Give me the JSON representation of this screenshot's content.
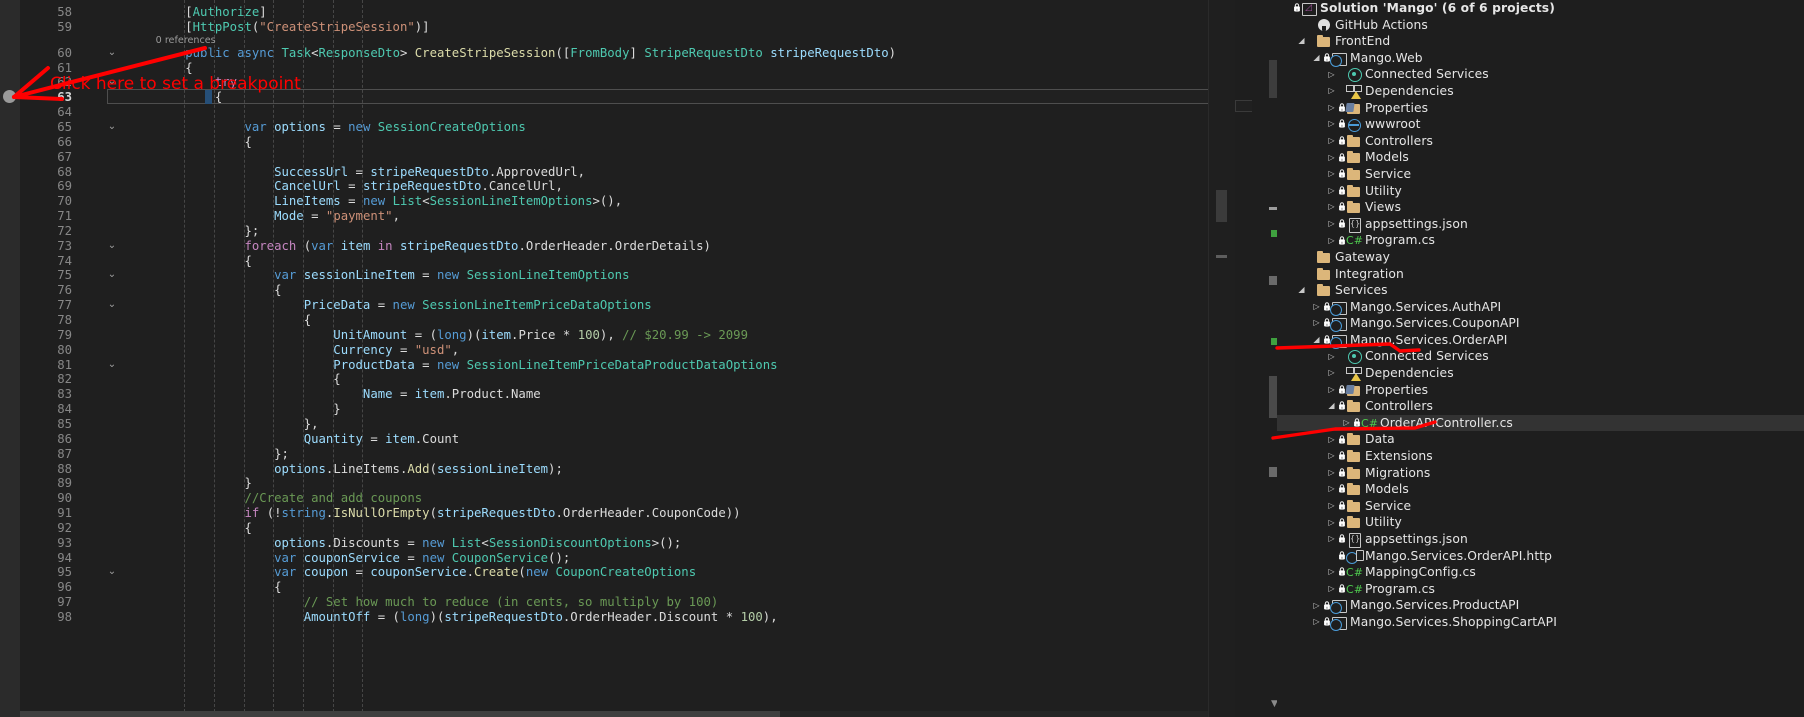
{
  "editor": {
    "file": "OrderAPIController.cs",
    "current_line": 63,
    "breakpoint_marker": "breakpoint-placeholder-dot",
    "lines": [
      {
        "n": 58,
        "fold": "",
        "indent": 4,
        "text": "[Authorize]"
      },
      {
        "n": 59,
        "fold": "",
        "indent": 4,
        "text": "[HttpPost(\"CreateStripeSession\")]"
      },
      {
        "n": "",
        "fold": "",
        "indent": 4,
        "text": "0 references",
        "kind": "codelens"
      },
      {
        "n": 60,
        "fold": "v",
        "indent": 4,
        "text": "public async Task<ResponseDto> CreateStripeSession([FromBody] StripeRequestDto stripeRequestDto)"
      },
      {
        "n": 61,
        "fold": "",
        "indent": 4,
        "text": "{"
      },
      {
        "n": 62,
        "fold": "v",
        "indent": 6,
        "text": "try"
      },
      {
        "n": 63,
        "fold": "",
        "indent": 6,
        "text": "{"
      },
      {
        "n": 64,
        "fold": "",
        "indent": 0,
        "text": ""
      },
      {
        "n": 65,
        "fold": "v",
        "indent": 8,
        "text": "var options = new SessionCreateOptions"
      },
      {
        "n": 66,
        "fold": "",
        "indent": 8,
        "text": "{"
      },
      {
        "n": 67,
        "fold": "",
        "indent": 0,
        "text": ""
      },
      {
        "n": 68,
        "fold": "",
        "indent": 10,
        "text": "SuccessUrl = stripeRequestDto.ApprovedUrl,"
      },
      {
        "n": 69,
        "fold": "",
        "indent": 10,
        "text": "CancelUrl = stripeRequestDto.CancelUrl,"
      },
      {
        "n": 70,
        "fold": "",
        "indent": 10,
        "text": "LineItems = new List<SessionLineItemOptions>(),"
      },
      {
        "n": 71,
        "fold": "",
        "indent": 10,
        "text": "Mode = \"payment\","
      },
      {
        "n": 72,
        "fold": "",
        "indent": 8,
        "text": "};"
      },
      {
        "n": 73,
        "fold": "v",
        "indent": 8,
        "text": "foreach (var item in stripeRequestDto.OrderHeader.OrderDetails)"
      },
      {
        "n": 74,
        "fold": "",
        "indent": 8,
        "text": "{"
      },
      {
        "n": 75,
        "fold": "v",
        "indent": 10,
        "text": "var sessionLineItem = new SessionLineItemOptions"
      },
      {
        "n": 76,
        "fold": "",
        "indent": 10,
        "text": "{"
      },
      {
        "n": 77,
        "fold": "v",
        "indent": 12,
        "text": "PriceData = new SessionLineItemPriceDataOptions"
      },
      {
        "n": 78,
        "fold": "",
        "indent": 12,
        "text": "{"
      },
      {
        "n": 79,
        "fold": "",
        "indent": 14,
        "text": "UnitAmount = (long)(item.Price * 100), // $20.99 -> 2099"
      },
      {
        "n": 80,
        "fold": "",
        "indent": 14,
        "text": "Currency = \"usd\","
      },
      {
        "n": 81,
        "fold": "v",
        "indent": 14,
        "text": "ProductData = new SessionLineItemPriceDataProductDataOptions"
      },
      {
        "n": 82,
        "fold": "",
        "indent": 14,
        "text": "{"
      },
      {
        "n": 83,
        "fold": "",
        "indent": 16,
        "text": "Name = item.Product.Name"
      },
      {
        "n": 84,
        "fold": "",
        "indent": 14,
        "text": "}"
      },
      {
        "n": 85,
        "fold": "",
        "indent": 12,
        "text": "},"
      },
      {
        "n": 86,
        "fold": "",
        "indent": 12,
        "text": "Quantity = item.Count"
      },
      {
        "n": 87,
        "fold": "",
        "indent": 10,
        "text": "};"
      },
      {
        "n": 88,
        "fold": "",
        "indent": 10,
        "text": "options.LineItems.Add(sessionLineItem);"
      },
      {
        "n": 89,
        "fold": "",
        "indent": 8,
        "text": "}"
      },
      {
        "n": 90,
        "fold": "",
        "indent": 8,
        "text": "//Create and add coupons"
      },
      {
        "n": 91,
        "fold": "",
        "indent": 8,
        "text": "if (!string.IsNullOrEmpty(stripeRequestDto.OrderHeader.CouponCode))"
      },
      {
        "n": 92,
        "fold": "",
        "indent": 8,
        "text": "{"
      },
      {
        "n": 93,
        "fold": "",
        "indent": 10,
        "text": "options.Discounts = new List<SessionDiscountOptions>();"
      },
      {
        "n": 94,
        "fold": "",
        "indent": 10,
        "text": "var couponService = new CouponService();"
      },
      {
        "n": 95,
        "fold": "v",
        "indent": 10,
        "text": "var coupon = couponService.Create(new CouponCreateOptions"
      },
      {
        "n": 96,
        "fold": "",
        "indent": 10,
        "text": "{"
      },
      {
        "n": 97,
        "fold": "",
        "indent": 12,
        "text": "// Set how much to reduce (in cents, so multiply by 100)"
      },
      {
        "n": 98,
        "fold": "",
        "indent": 12,
        "text": "AmountOff = (long)(stripeRequestDto.OrderHeader.Discount * 100),"
      }
    ],
    "codelens_label": "0 references"
  },
  "annotations": [
    {
      "id": "breakpoint-hint",
      "text": "Click here to set a breakpoint",
      "color": "#ff0000"
    }
  ],
  "solution_explorer": {
    "items": [
      {
        "depth": 0,
        "chev": "",
        "lock": true,
        "icon": "solution-icon",
        "label": "Solution 'Mango' (6 of 6 projects)",
        "bold": true,
        "selected": false
      },
      {
        "depth": 1,
        "chev": "",
        "lock": false,
        "icon": "github-icon",
        "label": "GitHub Actions",
        "bold": false,
        "selected": false
      },
      {
        "depth": 1,
        "chev": "open",
        "lock": false,
        "icon": "folder-icon",
        "label": "FrontEnd",
        "bold": false,
        "selected": false
      },
      {
        "depth": 2,
        "chev": "open",
        "lock": true,
        "icon": "project-web-icon",
        "label": "Mango.Web",
        "bold": false,
        "selected": false
      },
      {
        "depth": 3,
        "chev": "closed",
        "lock": false,
        "icon": "connected-services-icon",
        "label": "Connected Services",
        "bold": false,
        "selected": false
      },
      {
        "depth": 3,
        "chev": "closed",
        "lock": false,
        "icon": "dependencies-icon",
        "label": "Dependencies",
        "bold": false,
        "selected": false
      },
      {
        "depth": 3,
        "chev": "closed",
        "lock": true,
        "icon": "properties-icon",
        "label": "Properties",
        "bold": false,
        "selected": false
      },
      {
        "depth": 3,
        "chev": "closed",
        "lock": true,
        "icon": "wwwroot-icon",
        "label": "wwwroot",
        "bold": false,
        "selected": false
      },
      {
        "depth": 3,
        "chev": "closed",
        "lock": true,
        "icon": "folder-icon",
        "label": "Controllers",
        "bold": false,
        "selected": false
      },
      {
        "depth": 3,
        "chev": "closed",
        "lock": true,
        "icon": "folder-icon",
        "label": "Models",
        "bold": false,
        "selected": false
      },
      {
        "depth": 3,
        "chev": "closed",
        "lock": true,
        "icon": "folder-icon",
        "label": "Service",
        "bold": false,
        "selected": false
      },
      {
        "depth": 3,
        "chev": "closed",
        "lock": true,
        "icon": "folder-icon",
        "label": "Utility",
        "bold": false,
        "selected": false
      },
      {
        "depth": 3,
        "chev": "closed",
        "lock": true,
        "icon": "folder-icon",
        "label": "Views",
        "bold": false,
        "selected": false
      },
      {
        "depth": 3,
        "chev": "closed",
        "lock": true,
        "icon": "json-icon",
        "label": "appsettings.json",
        "bold": false,
        "selected": false
      },
      {
        "depth": 3,
        "chev": "closed",
        "lock": true,
        "icon": "csharp-icon",
        "label": "Program.cs",
        "bold": false,
        "selected": false
      },
      {
        "depth": 1,
        "chev": "",
        "lock": false,
        "icon": "folder-icon",
        "label": "Gateway",
        "bold": false,
        "selected": false
      },
      {
        "depth": 1,
        "chev": "",
        "lock": false,
        "icon": "folder-icon",
        "label": "Integration",
        "bold": false,
        "selected": false
      },
      {
        "depth": 1,
        "chev": "open",
        "lock": false,
        "icon": "folder-icon",
        "label": "Services",
        "bold": false,
        "selected": false
      },
      {
        "depth": 2,
        "chev": "closed",
        "lock": true,
        "icon": "project-web-icon",
        "label": "Mango.Services.AuthAPI",
        "bold": false,
        "selected": false
      },
      {
        "depth": 2,
        "chev": "closed",
        "lock": true,
        "icon": "project-web-icon",
        "label": "Mango.Services.CouponAPI",
        "bold": false,
        "selected": false
      },
      {
        "depth": 2,
        "chev": "open",
        "lock": true,
        "icon": "project-web-icon",
        "label": "Mango.Services.OrderAPI",
        "bold": false,
        "selected": false
      },
      {
        "depth": 3,
        "chev": "closed",
        "lock": false,
        "icon": "connected-services-icon",
        "label": "Connected Services",
        "bold": false,
        "selected": false
      },
      {
        "depth": 3,
        "chev": "closed",
        "lock": false,
        "icon": "dependencies-icon",
        "label": "Dependencies",
        "bold": false,
        "selected": false
      },
      {
        "depth": 3,
        "chev": "closed",
        "lock": true,
        "icon": "properties-icon",
        "label": "Properties",
        "bold": false,
        "selected": false
      },
      {
        "depth": 3,
        "chev": "open",
        "lock": true,
        "icon": "folder-icon",
        "label": "Controllers",
        "bold": false,
        "selected": false
      },
      {
        "depth": 4,
        "chev": "closed",
        "lock": true,
        "icon": "csharp-icon",
        "label": "OrderAPIController.cs",
        "bold": false,
        "selected": true
      },
      {
        "depth": 3,
        "chev": "closed",
        "lock": true,
        "icon": "folder-icon",
        "label": "Data",
        "bold": false,
        "selected": false
      },
      {
        "depth": 3,
        "chev": "closed",
        "lock": true,
        "icon": "folder-icon",
        "label": "Extensions",
        "bold": false,
        "selected": false
      },
      {
        "depth": 3,
        "chev": "closed",
        "lock": true,
        "icon": "folder-icon",
        "label": "Migrations",
        "bold": false,
        "selected": false
      },
      {
        "depth": 3,
        "chev": "closed",
        "lock": true,
        "icon": "folder-icon",
        "label": "Models",
        "bold": false,
        "selected": false
      },
      {
        "depth": 3,
        "chev": "closed",
        "lock": true,
        "icon": "folder-icon",
        "label": "Service",
        "bold": false,
        "selected": false
      },
      {
        "depth": 3,
        "chev": "closed",
        "lock": true,
        "icon": "folder-icon",
        "label": "Utility",
        "bold": false,
        "selected": false
      },
      {
        "depth": 3,
        "chev": "closed",
        "lock": true,
        "icon": "json-icon",
        "label": "appsettings.json",
        "bold": false,
        "selected": false
      },
      {
        "depth": 3,
        "chev": "",
        "lock": true,
        "icon": "http-file-icon",
        "label": "Mango.Services.OrderAPI.http",
        "bold": false,
        "selected": false
      },
      {
        "depth": 3,
        "chev": "closed",
        "lock": true,
        "icon": "csharp-icon",
        "label": "MappingConfig.cs",
        "bold": false,
        "selected": false
      },
      {
        "depth": 3,
        "chev": "closed",
        "lock": true,
        "icon": "csharp-icon",
        "label": "Program.cs",
        "bold": false,
        "selected": false
      },
      {
        "depth": 2,
        "chev": "closed",
        "lock": true,
        "icon": "project-web-icon",
        "label": "Mango.Services.ProductAPI",
        "bold": false,
        "selected": false
      },
      {
        "depth": 2,
        "chev": "closed",
        "lock": true,
        "icon": "project-web-icon",
        "label": "Mango.Services.ShoppingCartAPI",
        "bold": false,
        "selected": false
      }
    ]
  },
  "colors": {
    "editor_bg": "#1f1f1f",
    "panel_bg": "#1e1e1e",
    "gutter_bg": "#2b2b2b",
    "selection": "#333333",
    "annotation_red": "#ff0000",
    "keyword_blue": "#569cd6",
    "control_purple": "#c586c0",
    "type_teal": "#4ec9b0",
    "string_orange": "#ce9178",
    "comment_green": "#6a9955",
    "number_green": "#b5cea8",
    "identifier_lightblue": "#9cdcfe",
    "method_yellow": "#dcdcaa"
  }
}
